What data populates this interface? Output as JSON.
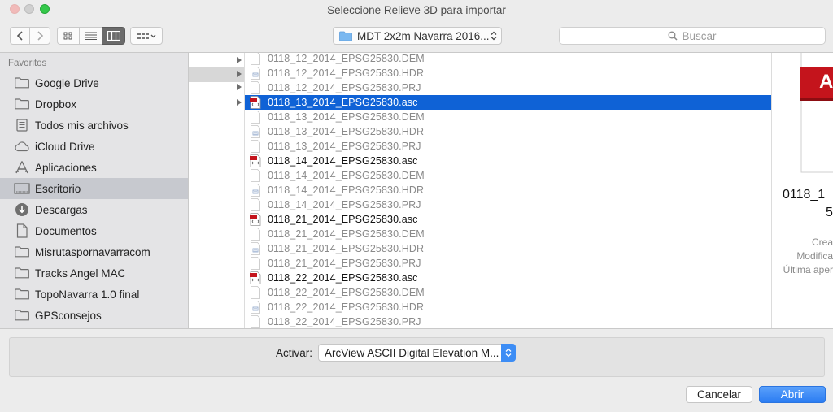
{
  "window": {
    "title": "Seleccione Relieve 3D para importar",
    "colors": {
      "close": "#fc605c",
      "minimize": "#d0d0d0",
      "zoom": "#34c84a",
      "accent": "#0f62d6"
    }
  },
  "toolbar": {
    "back_icon": "chevron-left-icon",
    "forward_icon": "chevron-right-icon",
    "view_modes": [
      "icon-view-icon",
      "list-view-icon",
      "column-view-icon",
      "cover-flow-icon"
    ],
    "selected_view": "column-view-icon",
    "location": "MDT 2x2m Navarra 2016...",
    "search_placeholder": "Buscar"
  },
  "sidebar": {
    "heading": "Favoritos",
    "items": [
      {
        "label": "Google Drive",
        "icon": "folder-icon"
      },
      {
        "label": "Dropbox",
        "icon": "folder-icon"
      },
      {
        "label": "Todos mis archivos",
        "icon": "all-files-icon"
      },
      {
        "label": "iCloud Drive",
        "icon": "cloud-icon"
      },
      {
        "label": "Aplicaciones",
        "icon": "applications-icon"
      },
      {
        "label": "Escritorio",
        "icon": "desktop-icon",
        "selected": true
      },
      {
        "label": "Descargas",
        "icon": "download-icon"
      },
      {
        "label": "Documentos",
        "icon": "document-icon"
      },
      {
        "label": "Misrutaspornavarracom",
        "icon": "folder-icon"
      },
      {
        "label": "Tracks Angel MAC",
        "icon": "folder-icon"
      },
      {
        "label": "TopoNavarra 1.0 final",
        "icon": "folder-icon"
      },
      {
        "label": "GPSconsejos",
        "icon": "folder-icon"
      }
    ]
  },
  "files": [
    {
      "name": "0118_12_2014_EPSG25830.DEM",
      "type": "dem"
    },
    {
      "name": "0118_12_2014_EPSG25830.HDR",
      "type": "hdr"
    },
    {
      "name": "0118_12_2014_EPSG25830.PRJ",
      "type": "prj"
    },
    {
      "name": "0118_13_2014_EPSG25830.asc",
      "type": "asc",
      "selected": true
    },
    {
      "name": "0118_13_2014_EPSG25830.DEM",
      "type": "dem"
    },
    {
      "name": "0118_13_2014_EPSG25830.HDR",
      "type": "hdr"
    },
    {
      "name": "0118_13_2014_EPSG25830.PRJ",
      "type": "prj"
    },
    {
      "name": "0118_14_2014_EPSG25830.asc",
      "type": "asc"
    },
    {
      "name": "0118_14_2014_EPSG25830.DEM",
      "type": "dem"
    },
    {
      "name": "0118_14_2014_EPSG25830.HDR",
      "type": "hdr"
    },
    {
      "name": "0118_14_2014_EPSG25830.PRJ",
      "type": "prj"
    },
    {
      "name": "0118_21_2014_EPSG25830.asc",
      "type": "asc"
    },
    {
      "name": "0118_21_2014_EPSG25830.DEM",
      "type": "dem"
    },
    {
      "name": "0118_21_2014_EPSG25830.HDR",
      "type": "hdr"
    },
    {
      "name": "0118_21_2014_EPSG25830.PRJ",
      "type": "prj"
    },
    {
      "name": "0118_22_2014_EPSG25830.asc",
      "type": "asc"
    },
    {
      "name": "0118_22_2014_EPSG25830.DEM",
      "type": "dem"
    },
    {
      "name": "0118_22_2014_EPSG25830.HDR",
      "type": "hdr"
    },
    {
      "name": "0118_22_2014_EPSG25830.PRJ",
      "type": "prj"
    }
  ],
  "preview": {
    "badge_text": "A",
    "name_line1": "0118_1",
    "name_line2": "5",
    "meta": [
      "Crea",
      "Modifica",
      "Última aper"
    ]
  },
  "options": {
    "label": "Activar:",
    "selected": "ArcView ASCII Digital Elevation M..."
  },
  "buttons": {
    "cancel": "Cancelar",
    "open": "Abrir"
  }
}
